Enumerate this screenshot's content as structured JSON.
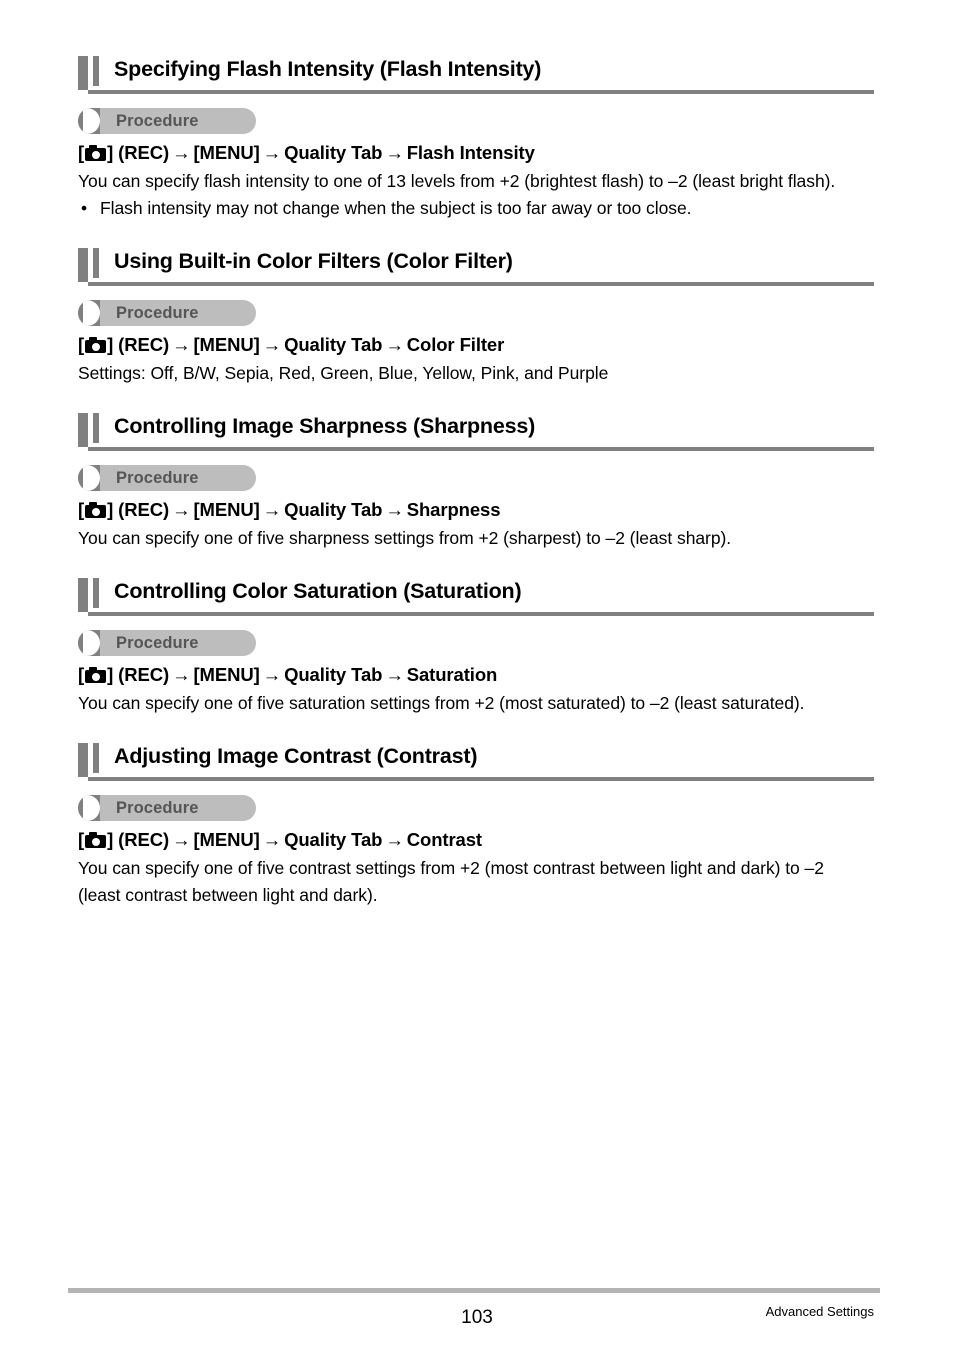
{
  "document": {
    "page_number": "103",
    "chapter_label": "Advanced Settings"
  },
  "icons": {
    "camera": "camera-icon"
  },
  "arrow_glyph": "→",
  "bullet_glyph": "•",
  "colors": {
    "heading_bar": "#808080",
    "heading_rule": "#808080",
    "pill_background": "#bdbdbd",
    "pill_tab": "#808080",
    "pill_text": "#555555",
    "footer_rule": "#b4b4b4",
    "text": "#000000"
  },
  "sections": [
    {
      "title": "Specifying Flash Intensity (Flash Intensity)",
      "procedure_label": "Procedure",
      "path": {
        "prefix": "[",
        "after_icon": "] (REC)",
        "steps": [
          "[MENU]",
          "Quality Tab",
          "Flash Intensity"
        ]
      },
      "paragraphs": [
        "You can specify flash intensity to one of 13 levels from +2 (brightest flash) to –2 (least bright flash)."
      ],
      "bullets": [
        "Flash intensity may not change when the subject is too far away or too close."
      ]
    },
    {
      "title": "Using Built-in Color Filters (Color Filter)",
      "procedure_label": "Procedure",
      "path": {
        "prefix": "[",
        "after_icon": "] (REC)",
        "steps": [
          "[MENU]",
          "Quality Tab",
          "Color Filter"
        ]
      },
      "paragraphs": [
        "Settings: Off, B/W, Sepia, Red, Green, Blue, Yellow, Pink, and Purple"
      ],
      "bullets": []
    },
    {
      "title": "Controlling Image Sharpness (Sharpness)",
      "procedure_label": "Procedure",
      "path": {
        "prefix": "[",
        "after_icon": "] (REC)",
        "steps": [
          "[MENU]",
          "Quality Tab",
          "Sharpness"
        ]
      },
      "paragraphs": [
        "You can specify one of five sharpness settings from +2 (sharpest) to –2 (least sharp)."
      ],
      "bullets": []
    },
    {
      "title": "Controlling Color Saturation (Saturation)",
      "procedure_label": "Procedure",
      "path": {
        "prefix": "[",
        "after_icon": "] (REC)",
        "steps": [
          "[MENU]",
          "Quality Tab",
          "Saturation"
        ]
      },
      "paragraphs": [
        "You can specify one of five saturation settings from +2 (most saturated) to –2 (least saturated)."
      ],
      "bullets": []
    },
    {
      "title": "Adjusting Image Contrast (Contrast)",
      "procedure_label": "Procedure",
      "path": {
        "prefix": "[",
        "after_icon": "] (REC)",
        "steps": [
          "[MENU]",
          "Quality Tab",
          "Contrast"
        ]
      },
      "paragraphs": [
        "You can specify one of five contrast settings from +2 (most contrast between light and dark) to –2 (least contrast between light and dark)."
      ],
      "bullets": []
    }
  ]
}
